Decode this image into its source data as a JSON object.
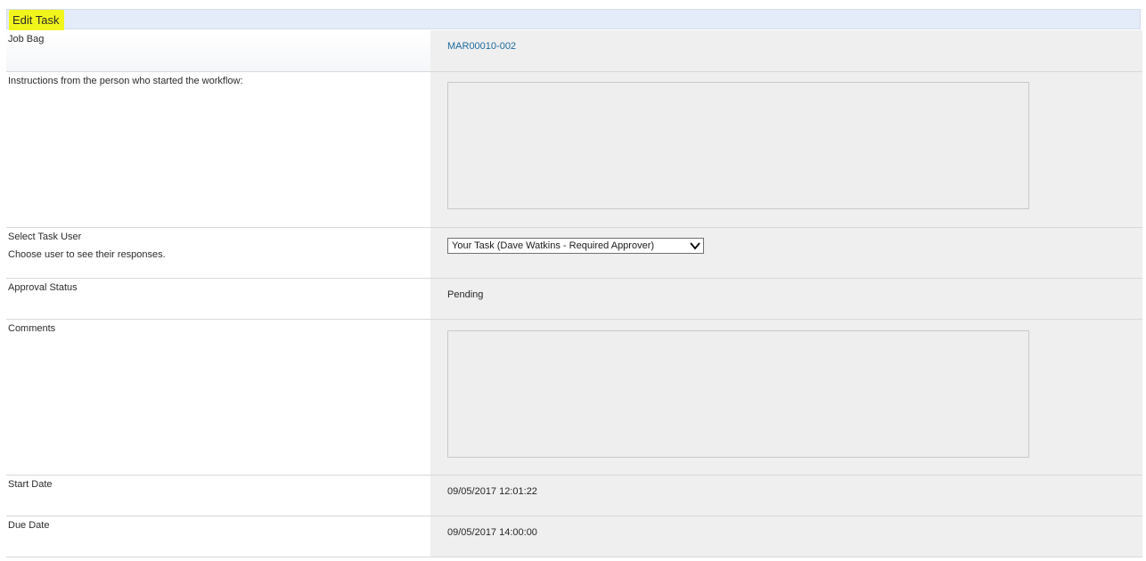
{
  "header": {
    "title": "Edit Task"
  },
  "fields": {
    "job_bag": {
      "label": "Job Bag",
      "value": "MAR00010-002"
    },
    "instructions": {
      "label": "Instructions from the person who started the workflow:",
      "value": ""
    },
    "task_user": {
      "label": "Select Task User",
      "sublabel": "Choose user to see their responses.",
      "selected": "Your Task (Dave Watkins - Required Approver)"
    },
    "approval_status": {
      "label": "Approval Status",
      "value": "Pending"
    },
    "comments": {
      "label": "Comments",
      "value": ""
    },
    "start_date": {
      "label": "Start Date",
      "value": "09/05/2017 12:01:22"
    },
    "due_date": {
      "label": "Due Date",
      "value": "09/05/2017 14:00:00"
    }
  },
  "icons": {
    "dropdown": "chevron-down-icon"
  }
}
